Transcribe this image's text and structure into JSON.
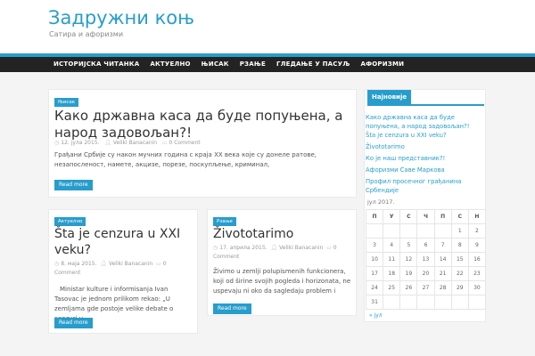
{
  "site": {
    "title": "Задружни коњ",
    "description": "Сатира и афоризми"
  },
  "nav": {
    "items": [
      "ИСТОРИЈСКА ЧИТАНКА",
      "АКТУЕЛНО",
      "ЊИСАК",
      "РЗАЊЕ",
      "ГЛЕДАЊЕ У ПАСУЉ",
      "АФОРИЗМИ"
    ]
  },
  "posts": [
    {
      "category": "Њисак",
      "title": "Како државна каса да буде попуњена, а народ задовољан?!",
      "date": "12. јула 2015.",
      "author": "Veliki Banacanin",
      "comments": "0 Comment",
      "excerpt": "Грађани Србије су након мучних година с краја XX века које су донеле ратове, незапосленост, намете, акцизе, порезе, поскупљење, криминал,",
      "read_more": "Read more"
    },
    {
      "category": "Актуелно",
      "title": "Šta je cenzura u XXI veku?",
      "date": "8. маја 2015.",
      "author": "Veliki Banacanin",
      "comments_num": "0",
      "comments_word": "Comment",
      "excerpt": "Ministar kulture i informisanja Ivan Tasovac je jednom prilikom rekao: „U zemljama gde postoje velike debate o cenzuri u",
      "read_more": "Read more"
    },
    {
      "category": "Рзање",
      "title": "Živototarimo",
      "date": "17. априла 2015.",
      "author": "Veliki Banacanin",
      "comments_num": "0",
      "comments_word": "Comment",
      "excerpt": "Živimo u zemlji polupismenih funkcionera, koji od širine svojih pogleda i horizonata, ne uspevaju ni oko da sagledaju problem i",
      "read_more": "Read more"
    }
  ],
  "sidebar": {
    "widget_title": "Најновије",
    "recent": [
      "Како државна каса да буде попуњена, а народ задовољан?!",
      "Šta je cenzura u XXI veku?",
      "Živototarimo",
      "Ко је наш представник?!",
      "Афоризми Саве Маркова",
      "Профил просечног грађанина Србендије"
    ],
    "calendar": {
      "caption": "јул 2017.",
      "headers": [
        "П",
        "У",
        "С",
        "Ч",
        "П",
        "С",
        "Н"
      ],
      "rows": [
        [
          "",
          "",
          "",
          "",
          "",
          "1",
          "2"
        ],
        [
          "3",
          "4",
          "5",
          "6",
          "7",
          "8",
          "9"
        ],
        [
          "10",
          "11",
          "12",
          "13",
          "14",
          "15",
          "16"
        ],
        [
          "17",
          "18",
          "19",
          "20",
          "21",
          "22",
          "23"
        ],
        [
          "24",
          "25",
          "26",
          "27",
          "28",
          "29",
          "30"
        ],
        [
          "31",
          "",
          "",
          "",
          "",
          "",
          ""
        ]
      ],
      "prev": "« јул"
    }
  },
  "colors": {
    "accent": "#289dcc",
    "nav_bg": "#232323"
  },
  "icons": {
    "calendar": "calendar-icon",
    "user": "user-icon",
    "comment": "comment-icon"
  }
}
